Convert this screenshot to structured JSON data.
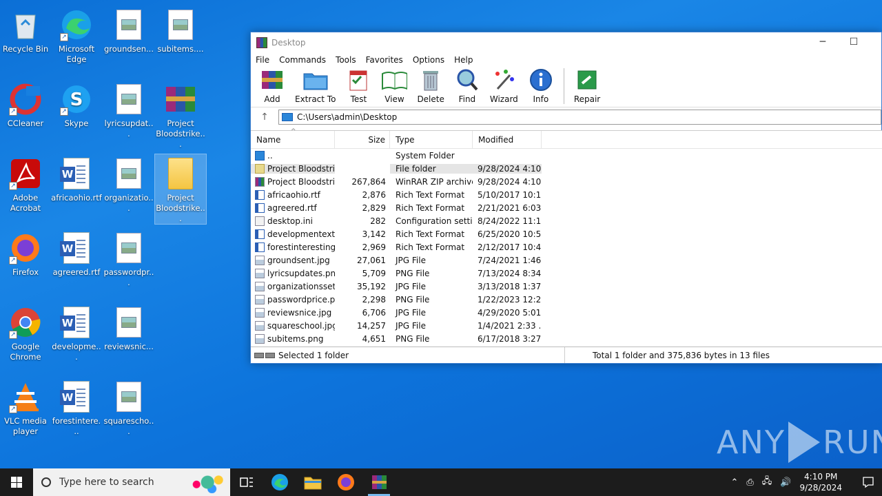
{
  "desktop_icons": [
    {
      "label": "Recycle Bin",
      "icon": "recycle-bin-icon"
    },
    {
      "label": "Microsoft Edge",
      "icon": "edge-icon"
    },
    {
      "label": "groundsen...",
      "icon": "image-file-icon"
    },
    {
      "label": "subitems....",
      "icon": "image-file-icon"
    },
    {
      "label": "CCleaner",
      "icon": "ccleaner-icon"
    },
    {
      "label": "Skype",
      "icon": "skype-icon"
    },
    {
      "label": "lyricsupdat...",
      "icon": "image-file-icon"
    },
    {
      "label": "Project Bloodstrike...",
      "icon": "winrar-archive-icon"
    },
    {
      "label": "Adobe Acrobat",
      "icon": "acrobat-icon"
    },
    {
      "label": "africaohio.rtf",
      "icon": "word-document-icon"
    },
    {
      "label": "organizatio...",
      "icon": "image-file-icon"
    },
    {
      "label": "Project Bloodstrike...",
      "icon": "folder-icon"
    },
    {
      "label": "Firefox",
      "icon": "firefox-icon"
    },
    {
      "label": "agreered.rtf",
      "icon": "word-document-icon"
    },
    {
      "label": "passwordpr...",
      "icon": "image-file-icon"
    },
    {
      "label": "Google Chrome",
      "icon": "chrome-icon"
    },
    {
      "label": "developme...",
      "icon": "word-document-icon"
    },
    {
      "label": "reviewsnic...",
      "icon": "image-file-icon"
    },
    {
      "label": "VLC media player",
      "icon": "vlc-icon"
    },
    {
      "label": "forestintere...",
      "icon": "word-document-icon"
    },
    {
      "label": "squarescho...",
      "icon": "image-file-icon"
    }
  ],
  "window": {
    "title": "Desktop",
    "menu": [
      "File",
      "Commands",
      "Tools",
      "Favorites",
      "Options",
      "Help"
    ],
    "toolbar": [
      "Add",
      "Extract To",
      "Test",
      "View",
      "Delete",
      "Find",
      "Wizard",
      "Info",
      "Repair"
    ],
    "address": "C:\\Users\\admin\\Desktop",
    "columns": [
      "Name",
      "Size",
      "Type",
      "Modified"
    ],
    "files": [
      {
        "name": "..",
        "size": "",
        "type": "System Folder",
        "modified": "",
        "kind": "sysf"
      },
      {
        "name": "Project Bloodstri...",
        "size": "",
        "type": "File folder",
        "modified": "9/28/2024 4:10 ...",
        "kind": "folder"
      },
      {
        "name": "Project Bloodstri...",
        "size": "267,864",
        "type": "WinRAR ZIP archive",
        "modified": "9/28/2024 4:10 ...",
        "kind": "zip"
      },
      {
        "name": "africaohio.rtf",
        "size": "2,876",
        "type": "Rich Text Format",
        "modified": "5/10/2017 10:1...",
        "kind": "rtf"
      },
      {
        "name": "agreered.rtf",
        "size": "2,829",
        "type": "Rich Text Format",
        "modified": "2/21/2021 6:03 ...",
        "kind": "rtf"
      },
      {
        "name": "desktop.ini",
        "size": "282",
        "type": "Configuration setti...",
        "modified": "8/24/2022 11:1...",
        "kind": "ini"
      },
      {
        "name": "developmentext...",
        "size": "3,142",
        "type": "Rich Text Format",
        "modified": "6/25/2020 10:5...",
        "kind": "rtf"
      },
      {
        "name": "forestinteresting...",
        "size": "2,969",
        "type": "Rich Text Format",
        "modified": "2/12/2017 10:4...",
        "kind": "rtf"
      },
      {
        "name": "groundsent.jpg",
        "size": "27,061",
        "type": "JPG File",
        "modified": "7/24/2021 1:46 ...",
        "kind": "img"
      },
      {
        "name": "lyricsupdates.png",
        "size": "5,709",
        "type": "PNG File",
        "modified": "7/13/2024 8:34 ...",
        "kind": "img"
      },
      {
        "name": "organizationsset...",
        "size": "35,192",
        "type": "JPG File",
        "modified": "3/13/2018 1:37 ...",
        "kind": "img"
      },
      {
        "name": "passwordprice.p...",
        "size": "2,298",
        "type": "PNG File",
        "modified": "1/22/2023 12:2...",
        "kind": "img"
      },
      {
        "name": "reviewsnice.jpg",
        "size": "6,706",
        "type": "JPG File",
        "modified": "4/29/2020 5:01 ...",
        "kind": "img"
      },
      {
        "name": "squareschool.jpg",
        "size": "14,257",
        "type": "JPG File",
        "modified": "1/4/2021 2:33 ...",
        "kind": "img"
      },
      {
        "name": "subitems.png",
        "size": "4,651",
        "type": "PNG File",
        "modified": "6/17/2018 3:27 ...",
        "kind": "img"
      }
    ],
    "status_left": "Selected 1 folder",
    "status_right": "Total 1 folder and 375,836 bytes in 13 files"
  },
  "watermark": {
    "left": "ANY",
    "right": "RUN"
  },
  "taskbar": {
    "search_placeholder": "Type here to search",
    "time": "4:10 PM",
    "date": "9/28/2024"
  }
}
